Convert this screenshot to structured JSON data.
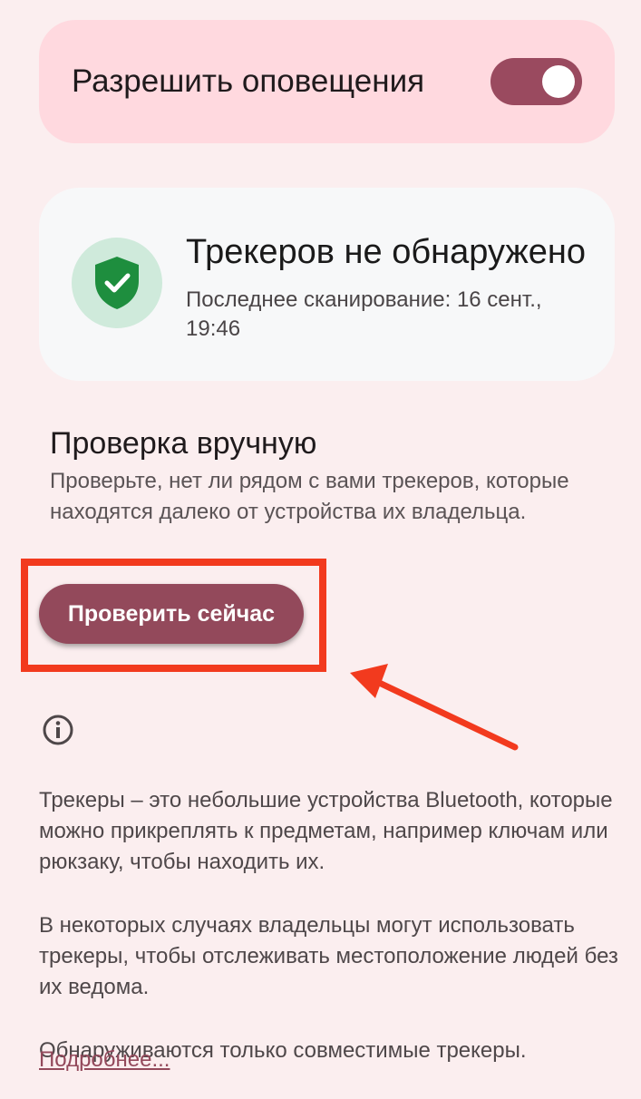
{
  "notifications": {
    "label": "Разрешить оповещения",
    "enabled": true
  },
  "status": {
    "title": "Трекеров не обнаружено",
    "subtitle": "Последнее сканирование: 16 сент., 19:46",
    "icon": "shield-check-icon"
  },
  "manual": {
    "title": "Проверка вручную",
    "description": "Проверьте, нет ли рядом с вами трекеров, которые находятся далеко от устройства их владельца.",
    "button_label": "Проверить сейчас"
  },
  "info": {
    "icon": "info-icon",
    "paragraphs": [
      "Трекеры – это небольшие устройства Bluetooth, которые можно прикреплять к предметам, например ключам или рюкзаку, чтобы находить их.",
      "В некоторых случаях владельцы могут использовать трекеры, чтобы отслеживать местоположение людей без их ведома.",
      "Обнаруживаются только совместимые трекеры."
    ],
    "link_label": "Подробнее..."
  },
  "colors": {
    "accent": "#93495b",
    "highlight": "#f23a1e",
    "toggle_card": "#ffd9df",
    "shield": "#1e8e3e"
  }
}
